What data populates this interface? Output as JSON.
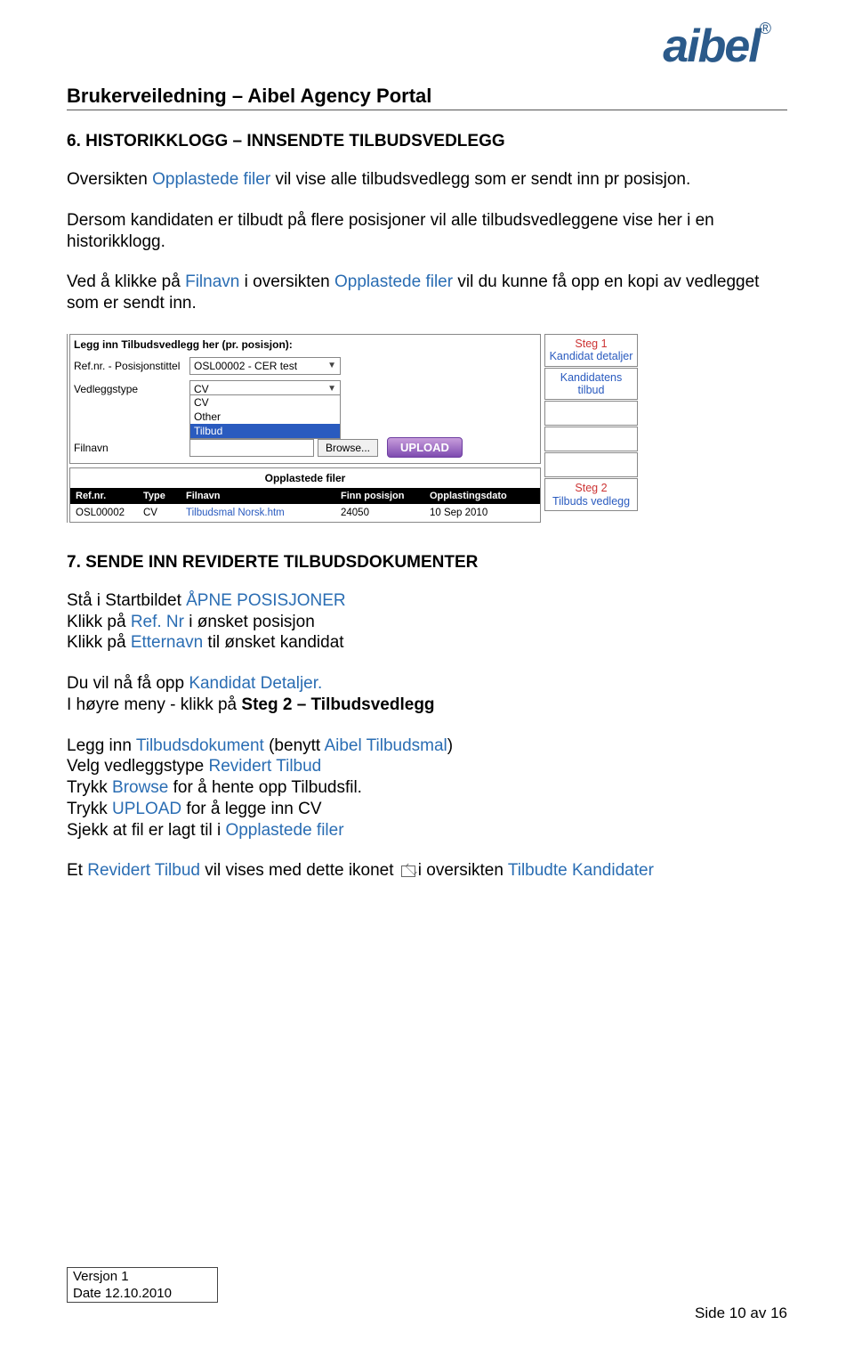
{
  "header": {
    "logo_text": "aibel",
    "logo_reg": "®",
    "doc_title": "Brukerveiledning – Aibel Agency Portal"
  },
  "section6": {
    "heading": "6. HISTORIKKLOGG – INNSENDTE TILBUDSVEDLEGG",
    "p1_pre": "Oversikten ",
    "p1_link": "Opplastede filer",
    "p1_post": " vil vise alle tilbudsvedlegg som er sendt inn pr posisjon.",
    "p2": "Dersom kandidaten er tilbudt på flere posisjoner vil alle tilbudsvedleggene vise her i en historikklogg.",
    "p3_pre": "Ved å klikke på ",
    "p3_l1": "Filnavn",
    "p3_mid": "  i oversikten ",
    "p3_l2": "Opplastede filer",
    "p3_post": " vil du kunne få opp en kopi av vedlegget som er sendt inn."
  },
  "screenshot": {
    "panel_title": "Legg inn Tilbudsvedlegg her (pr. posisjon):",
    "row_ref_label": "Ref.nr. - Posisjonstittel",
    "row_ref_value": "OSL00002 - CER test",
    "row_type_label": "Vedleggstype",
    "row_type_value": "CV",
    "dd_options": [
      "CV",
      "Other",
      "Tilbud"
    ],
    "row_file_label": "Filnavn",
    "browse": "Browse...",
    "upload": "UPLOAD",
    "uploaded_title": "Opplastede filer",
    "uh_ref": "Ref.nr.",
    "uh_type": "Type",
    "uh_fil": "Filnavn",
    "uh_pos": "Finn posisjon",
    "uh_dato": "Opplastingsdato",
    "ur": {
      "ref": "OSL00002",
      "type": "CV",
      "fil": "Tilbudsmal Norsk.htm",
      "pos": "24050",
      "dato": "10 Sep 2010"
    },
    "side": {
      "steg1_t": "Steg 1",
      "steg1_s": "Kandidat detaljer",
      "kt": "Kandidatens tilbud",
      "steg2_t": "Steg 2",
      "steg2_s": "Tilbuds vedlegg"
    }
  },
  "section7": {
    "heading": "7. SENDE INN REVIDERTE TILBUDSDOKUMENTER",
    "l1_pre": "Stå i Startbildet ",
    "l1_link": "ÅPNE POSISJONER",
    "l2_pre": "Klikk på ",
    "l2_link": "Ref. Nr",
    "l2_post": " i ønsket posisjon",
    "l3_pre": "Klikk på ",
    "l3_link": "Etternavn",
    "l3_post": " til ønsket kandidat",
    "l4_pre": "Du vil nå få opp ",
    "l4_link": "Kandidat Detaljer.",
    "l5_pre": "I høyre meny - klikk på ",
    "l5_bold": "Steg 2 – Tilbudsvedlegg",
    "l6_pre": "Legg inn ",
    "l6_l1": "Tilbudsdokument",
    "l6_mid": " (benytt ",
    "l6_l2": "Aibel Tilbudsmal",
    "l6_post": ")",
    "l7_pre": "Velg vedleggstype ",
    "l7_link": "Revidert Tilbud",
    "l8_pre": "Trykk ",
    "l8_link": "Browse",
    "l8_post": " for å hente opp Tilbudsfil.",
    "l9_pre": "Trykk ",
    "l9_link": "UPLOAD",
    "l9_post": " for å legge inn CV",
    "l10_pre": "Sjekk at fil er lagt til i ",
    "l10_link": "Opplastede filer",
    "l11_pre": "Et ",
    "l11_l1": "Revidert Tilbud",
    "l11_mid": " vil vises med dette ikonet ",
    "l11_post": "i oversikten ",
    "l11_l2": "Tilbudte Kandidater"
  },
  "footer": {
    "v": "Versjon 1",
    "d": "Date 12.10.2010",
    "page": "Side 10 av 16"
  }
}
